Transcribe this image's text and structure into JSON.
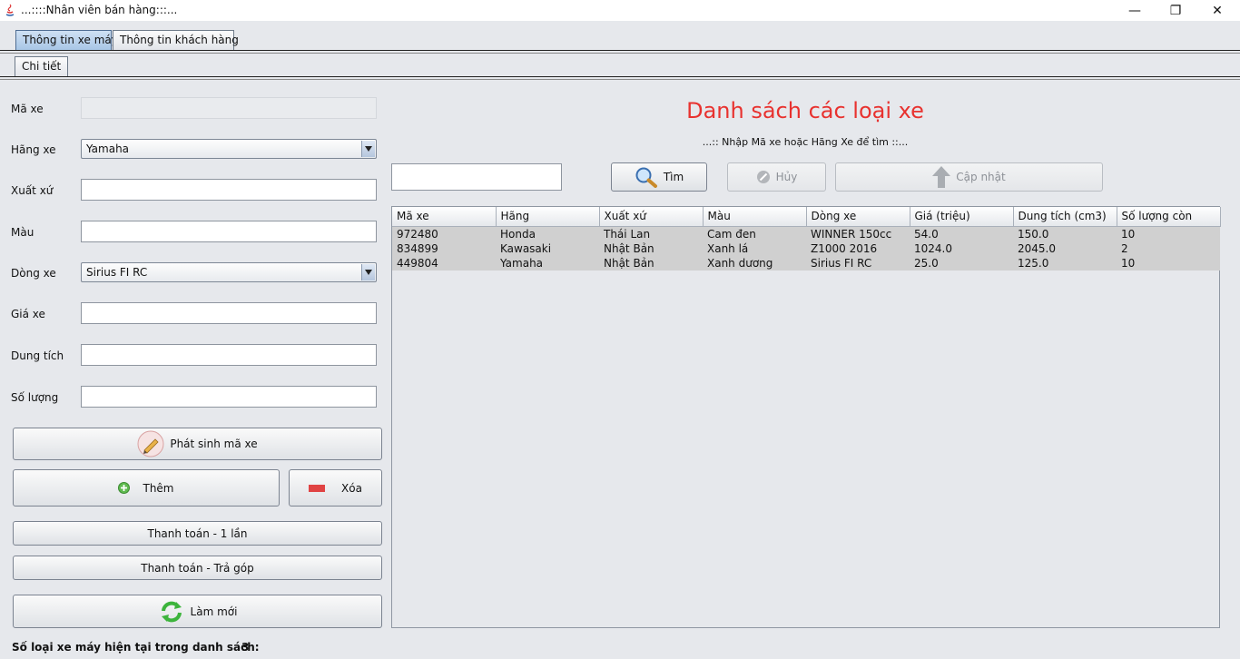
{
  "window": {
    "title": "...::::Nhân viên bán hàng:::...",
    "minimize": "—",
    "restore": "❐",
    "close": "✕"
  },
  "tabs": [
    {
      "label": "Thông tin xe máy",
      "active": true
    },
    {
      "label": "Thông tin khách hàng",
      "active": false
    }
  ],
  "subtab": {
    "label": "Chi tiết"
  },
  "form": {
    "ma_xe": {
      "label": "Mã xe",
      "value": ""
    },
    "hang_xe": {
      "label": "Hãng xe",
      "value": "Yamaha"
    },
    "xuat_xu": {
      "label": "Xuất xứ",
      "value": ""
    },
    "mau": {
      "label": "Màu",
      "value": ""
    },
    "dong_xe": {
      "label": "Dòng xe",
      "value": "Sirius FI RC"
    },
    "gia_xe": {
      "label": "Giá xe",
      "value": ""
    },
    "dung_tich": {
      "label": "Dung tích",
      "value": ""
    },
    "so_luong": {
      "label": "Số lượng",
      "value": ""
    }
  },
  "buttons": {
    "generate": "Phát sinh mã xe",
    "add": "Thêm",
    "delete": "Xóa",
    "pay_once": "Thanh toán - 1 lần",
    "pay_installment": "Thanh toán - Trả góp",
    "refresh": "Làm mới",
    "search": "Tìm",
    "cancel": "Hủy",
    "update": "Cập nhật"
  },
  "list": {
    "heading": "Danh sách các loại xe",
    "hint": "...:: Nhập Mã xe hoặc Hãng Xe để tìm ::...",
    "search_value": "",
    "columns": [
      "Mã xe",
      "Hãng",
      "Xuất xứ",
      "Màu",
      "Dòng xe",
      "Giá (triệu)",
      "Dung tích (cm3)",
      "Số lượng còn"
    ],
    "rows": [
      [
        "972480",
        "Honda",
        "Thái Lan",
        "Cam đen",
        "WINNER 150cc",
        "54.0",
        "150.0",
        "10"
      ],
      [
        "834899",
        "Kawasaki",
        "Nhật Bản",
        "Xanh lá",
        "Z1000 2016",
        "1024.0",
        "2045.0",
        "2"
      ],
      [
        "449804",
        "Yamaha",
        "Nhật Bản",
        "Xanh dương",
        "Sirius FI RC",
        "25.0",
        "125.0",
        "10"
      ]
    ]
  },
  "footer": {
    "label": "Số loại xe máy hiện tại trong danh sách:",
    "count": "3"
  },
  "colors": {
    "heading": "#e8322f",
    "background": "#e6e8ec",
    "row": "#d0d0d0"
  }
}
